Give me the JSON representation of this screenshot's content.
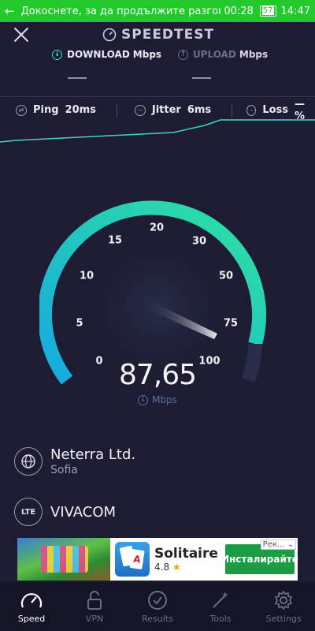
{
  "status_bar": {
    "call_text": "Докоснете, за да продължите разгово...",
    "call_timer": "00:28",
    "battery": "57",
    "clock": "14:47"
  },
  "header": {
    "brand": "SPEEDTEST",
    "download_label": "DOWNLOAD",
    "download_unit": "Mbps",
    "upload_label": "UPLOAD",
    "upload_unit": "Mbps"
  },
  "stats": {
    "ping_label": "Ping",
    "ping_value": "20ms",
    "jitter_label": "Jitter",
    "jitter_value": "6ms",
    "loss_label": "Loss",
    "loss_value": "— %"
  },
  "gauge": {
    "scale": [
      "0",
      "5",
      "10",
      "15",
      "20",
      "30",
      "50",
      "75",
      "100"
    ],
    "speed": "87,65",
    "unit": "Mbps",
    "value": 87.65,
    "accent_start": "#17a9e0",
    "accent_end": "#2ee3a0"
  },
  "server": {
    "name": "Neterra Ltd.",
    "city": "Sofia"
  },
  "provider": {
    "badge": "LTE",
    "name": "VIVACOM"
  },
  "ad": {
    "title": "Solitaire",
    "rating": "4.8",
    "cta": "Инсталирайте",
    "tag": "Рек..."
  },
  "nav": [
    {
      "label": "Speed",
      "icon": "speedometer-icon",
      "active": true
    },
    {
      "label": "VPN",
      "icon": "lock-icon",
      "active": false
    },
    {
      "label": "Results",
      "icon": "check-circle-icon",
      "active": false
    },
    {
      "label": "Tools",
      "icon": "magic-wand-icon",
      "active": false
    },
    {
      "label": "Settings",
      "icon": "gear-icon",
      "active": false
    }
  ]
}
